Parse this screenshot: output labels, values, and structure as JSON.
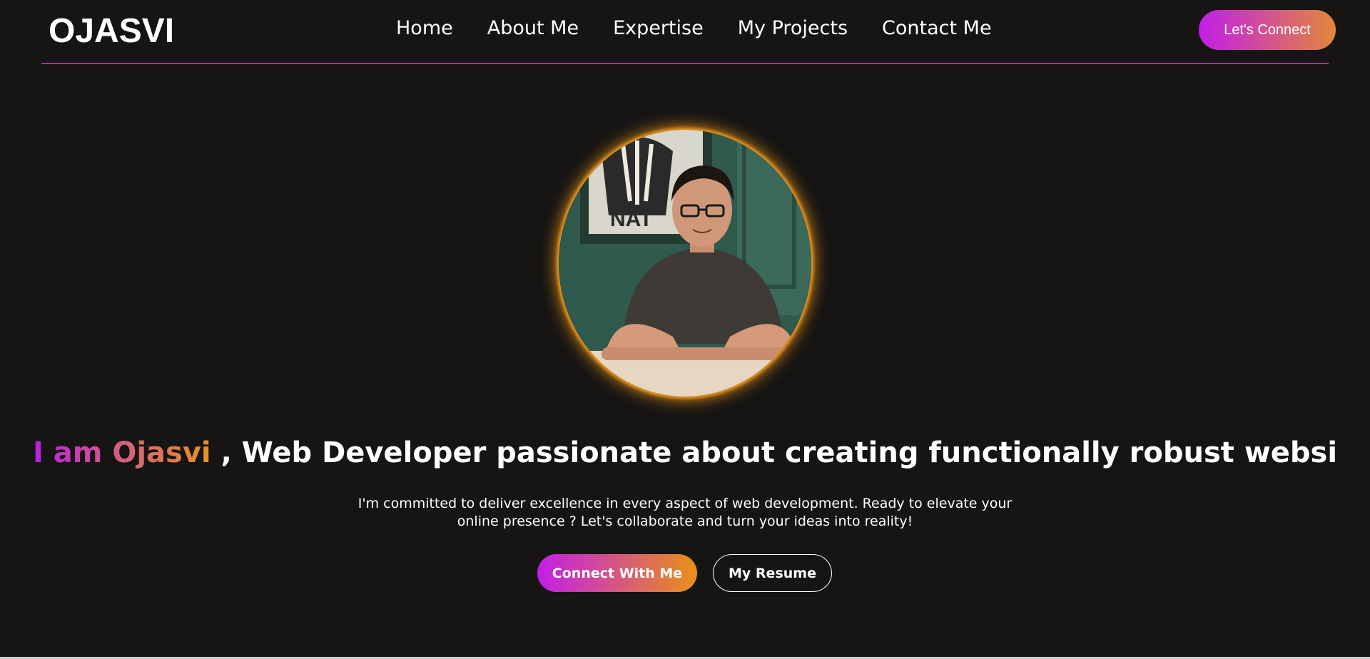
{
  "brand": {
    "logo_text": "OJASVI"
  },
  "nav": {
    "items": [
      {
        "label": "Home"
      },
      {
        "label": "About Me"
      },
      {
        "label": "Expertise"
      },
      {
        "label": "My Projects"
      },
      {
        "label": "Contact Me"
      }
    ],
    "cta_label": "Let's Connect"
  },
  "hero": {
    "avatar_icon": "profile-photo",
    "poster_text": "NAT",
    "headline_name": "I am Ojasvi",
    "headline_rest": ", Web Developer passionate about creating functionally robust websi",
    "tagline": "I'm committed to deliver excellence in every aspect of web development. Ready to elevate your online presence ? Let's collaborate and turn your ideas into reality!",
    "primary_button": "Connect With Me",
    "secondary_button": "My Resume"
  },
  "colors": {
    "background": "#161514",
    "accent_purple": "#c21ee8",
    "accent_orange": "#e99118",
    "avatar_glow": "#f0960f"
  }
}
